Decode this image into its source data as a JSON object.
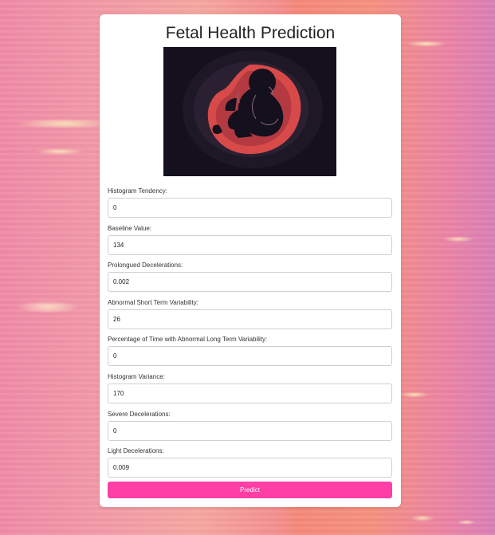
{
  "page": {
    "title": "Fetal Health Prediction"
  },
  "hero": {
    "icon": "fetus-illustration-icon"
  },
  "form": {
    "fields": [
      {
        "label": "Histogram Tendency:",
        "value": "0"
      },
      {
        "label": "Baseline Value:",
        "value": "134"
      },
      {
        "label": "Prolongued Decelerations:",
        "value": "0.002"
      },
      {
        "label": "Abnormal Short Term Variability:",
        "value": "26"
      },
      {
        "label": "Percentage of Time with Abnormal Long Term Variability:",
        "value": "0"
      },
      {
        "label": "Histogram Variance:",
        "value": "170"
      },
      {
        "label": "Severe Decelerations:",
        "value": "0"
      },
      {
        "label": "Light Decelerations:",
        "value": "0.009"
      }
    ],
    "submit_label": "Predict"
  },
  "colors": {
    "accent": "#ff3fa5",
    "card": "#ffffff",
    "hero_bg": "#15101d"
  }
}
